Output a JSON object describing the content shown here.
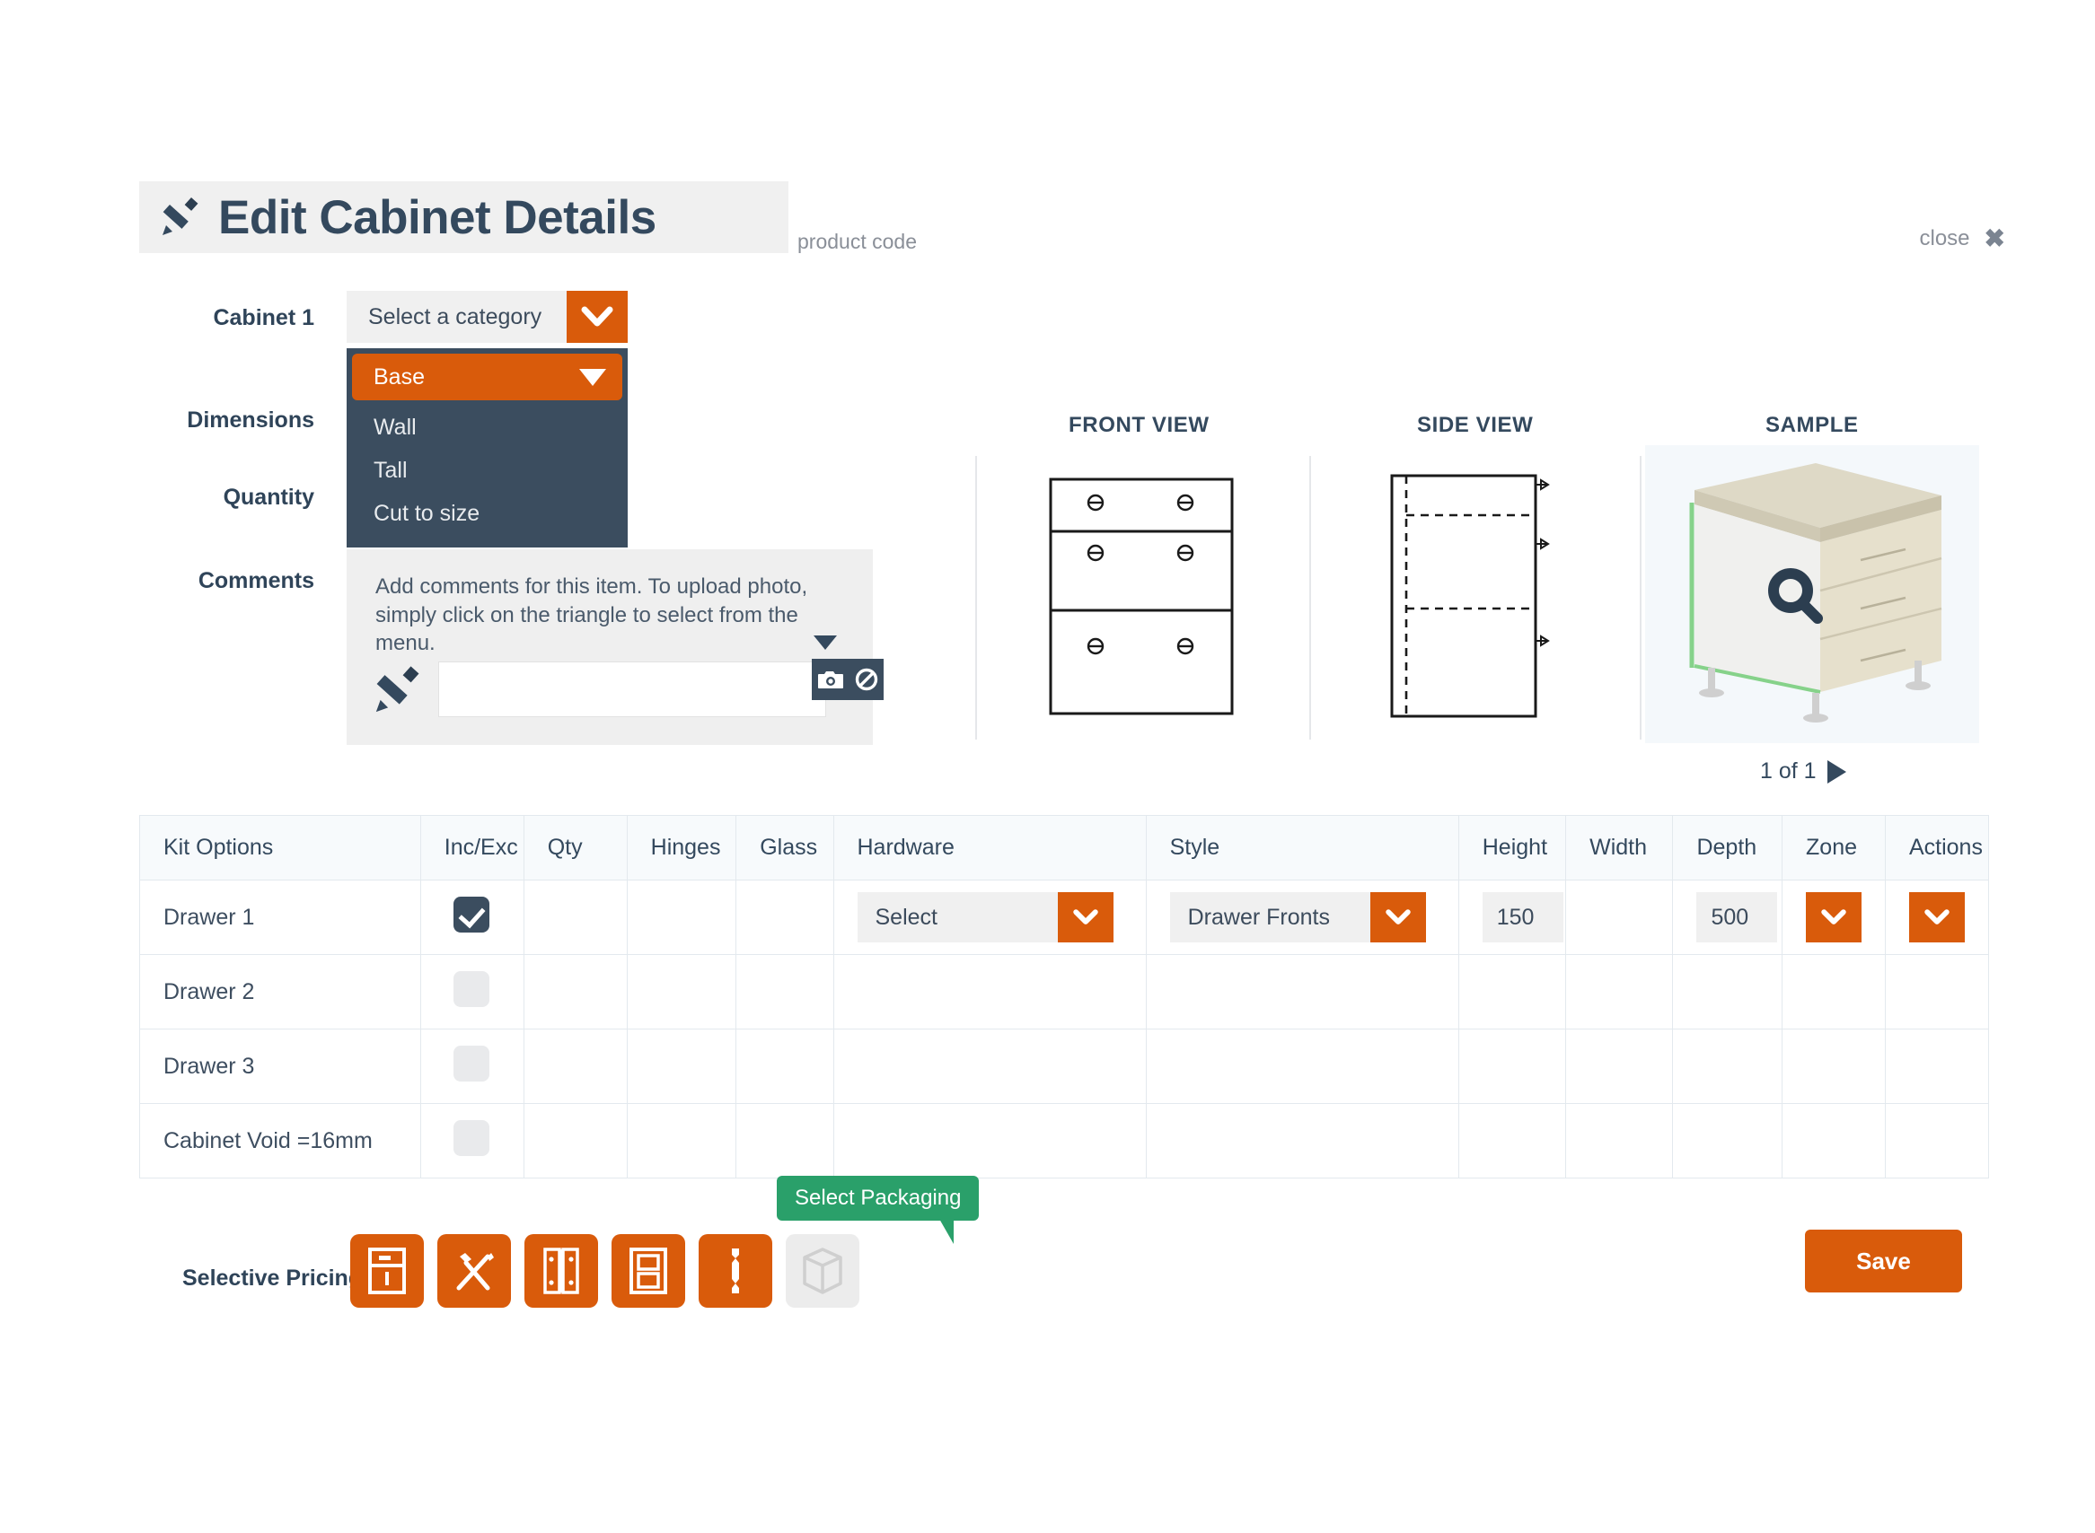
{
  "header": {
    "title": "Edit Cabinet Details",
    "pencil_icon": "pencil-icon",
    "product_code": "product code",
    "close_label": "close",
    "close_icon": "close-x-icon"
  },
  "form": {
    "cabinet_label": "Cabinet 1",
    "dimensions_label": "Dimensions",
    "quantity_label": "Quantity",
    "comments_label": "Comments",
    "category_select": {
      "value": "Select a category",
      "caret_icon": "chevron-down-icon",
      "open": true,
      "options": [
        {
          "label": "Base",
          "selected": true
        },
        {
          "label": "Wall",
          "selected": false
        },
        {
          "label": "Tall",
          "selected": false
        },
        {
          "label": "Cut to size",
          "selected": false
        }
      ]
    },
    "comments": {
      "help_text": "Add comments for this item. To upload photo, simply click on the triangle to select from the menu.",
      "input_value": "",
      "pencil_icon": "pencil-icon",
      "menu_triangle_icon": "triangle-down-icon",
      "camera_icon": "camera-icon",
      "no_photo_icon": "no-photo-icon"
    }
  },
  "views": {
    "front_label": "FRONT VIEW",
    "side_label": "SIDE VIEW",
    "sample_label": "SAMPLE",
    "sample_zoom_icon": "magnifier-icon",
    "pager_text": "1 of 1",
    "pager_next_icon": "triangle-right-icon"
  },
  "table": {
    "columns": [
      "Kit Options",
      "Inc/Exc",
      "Qty",
      "Hinges",
      "Glass",
      "Hardware",
      "Style",
      "Height",
      "Width",
      "Depth",
      "Zone",
      "Actions"
    ],
    "rows": [
      {
        "kit": "Drawer 1",
        "checked": true,
        "qty": "",
        "hinges": "",
        "glass": "",
        "hardware": "Select",
        "style": "Drawer Fronts",
        "height": "150",
        "width": "",
        "depth": "500",
        "zone_caret": "chevron-down-icon",
        "actions_caret": "chevron-down-icon",
        "has_controls": true
      },
      {
        "kit": "Drawer 2",
        "checked": false,
        "qty": "",
        "hinges": "",
        "glass": "",
        "hardware": "",
        "style": "",
        "height": "",
        "width": "",
        "depth": "",
        "has_controls": false
      },
      {
        "kit": "Drawer 3",
        "checked": false,
        "qty": "",
        "hinges": "",
        "glass": "",
        "hardware": "",
        "style": "",
        "height": "",
        "width": "",
        "depth": "",
        "has_controls": false
      },
      {
        "kit": "Cabinet Void =16mm",
        "checked": false,
        "qty": "",
        "hinges": "",
        "glass": "",
        "hardware": "",
        "style": "",
        "height": "",
        "width": "",
        "depth": "",
        "has_controls": false
      }
    ]
  },
  "bottom": {
    "selective_pricing_label": "Selective Pricing",
    "icons": [
      {
        "name": "cabinet-icon",
        "active": true
      },
      {
        "name": "tools-icon",
        "active": true
      },
      {
        "name": "hinge-icon",
        "active": true
      },
      {
        "name": "door-panel-icon",
        "active": true
      },
      {
        "name": "spindle-icon",
        "active": true
      },
      {
        "name": "package-box-icon",
        "active": false
      }
    ],
    "tooltip": "Select Packaging",
    "save_label": "Save"
  },
  "colors": {
    "orange": "#d95b0b",
    "navy": "#3b4d5f",
    "green": "#2aa06a",
    "grey": "#f0f0f0"
  }
}
